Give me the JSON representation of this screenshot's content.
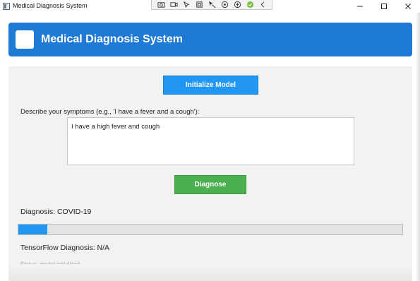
{
  "window": {
    "title": "Medical Diagnosis System",
    "controls": [
      "minimize-icon",
      "maximize-icon",
      "close-icon"
    ]
  },
  "recorder_toolbar": {
    "icons": [
      "screenshot-icon",
      "video-icon",
      "pointer-icon",
      "region-icon",
      "cursor-icon",
      "audio-icon",
      "accessibility-icon",
      "check-icon",
      "collapse-icon"
    ]
  },
  "header": {
    "title": "Medical Diagnosis System",
    "color": "#1f7ad6"
  },
  "main": {
    "init_button_label": "Initialize Model",
    "symptom_label": "Describe your symptoms (e.g., 'I have a fever and a cough'):",
    "symptom_value": "I have a high fever and cough",
    "diagnose_button_label": "Diagnose",
    "diagnosis_text": "Diagnosis: COVID-19",
    "progress_fraction": 0.075,
    "tf_diagnosis_text": "TensorFlow Diagnosis: N/A",
    "status_text": "Status: model initialized"
  },
  "colors": {
    "primary_button": "#2196f3",
    "diagnose_button": "#4caf50",
    "progress_fill": "#2196f3"
  }
}
